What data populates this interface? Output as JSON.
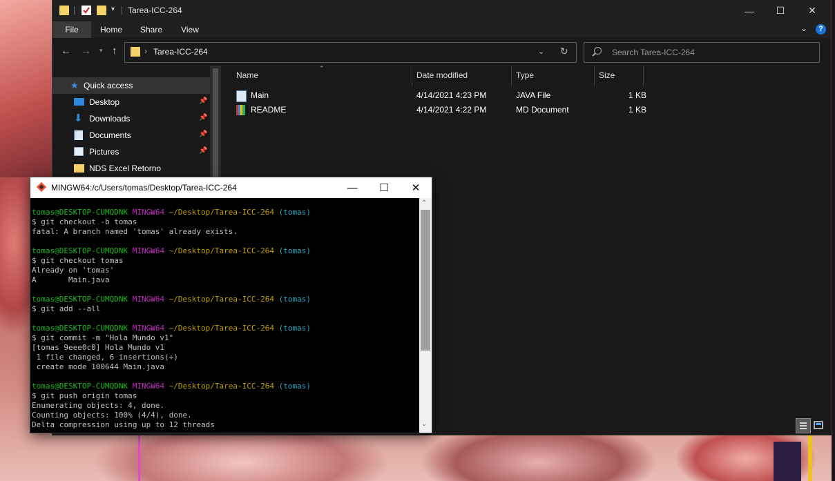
{
  "explorer": {
    "title": "Tarea-ICC-264",
    "ribbon_tabs": [
      "File",
      "Home",
      "Share",
      "View"
    ],
    "help": "?",
    "address": {
      "segment": "Tarea-ICC-264"
    },
    "search": {
      "placeholder": "Search Tarea-ICC-264"
    },
    "nav": [
      {
        "label": "Quick access",
        "icon": "star-icon",
        "pinned": false
      },
      {
        "label": "Desktop",
        "icon": "desktop-icon",
        "pinned": true
      },
      {
        "label": "Downloads",
        "icon": "download-icon",
        "pinned": true
      },
      {
        "label": "Documents",
        "icon": "documents-icon",
        "pinned": true
      },
      {
        "label": "Pictures",
        "icon": "pictures-icon",
        "pinned": true
      },
      {
        "label": "NDS Excel Retorno",
        "icon": "folder-icon",
        "pinned": false
      }
    ],
    "columns": [
      "Name",
      "Date modified",
      "Type",
      "Size"
    ],
    "files": [
      {
        "name": "Main",
        "date": "4/14/2021 4:23 PM",
        "type": "JAVA File",
        "size": "1 KB",
        "icon": "java-file-icon"
      },
      {
        "name": "README",
        "date": "4/14/2021 4:22 PM",
        "type": "MD Document",
        "size": "1 KB",
        "icon": "md-file-icon"
      }
    ]
  },
  "terminal": {
    "title": "MINGW64:/c/Users/tomas/Desktop/Tarea-ICC-264",
    "prompt": {
      "user": "tomas@DESKTOP-CUMQDNK",
      "shell": "MINGW64",
      "path": "~/Desktop/Tarea-ICC-264",
      "branch": "(tomas)"
    },
    "blocks": [
      {
        "command": "$ git checkout -b tomas",
        "output": [
          "fatal: A branch named 'tomas' already exists."
        ]
      },
      {
        "command": "$ git checkout tomas",
        "output": [
          "Already on 'tomas'",
          "A       Main.java"
        ]
      },
      {
        "command": "$ git add --all",
        "output": []
      },
      {
        "command": "$ git commit -m \"Hola Mundo v1\"",
        "output": [
          "[tomas 9eee0c0] Hola Mundo v1",
          " 1 file changed, 6 insertions(+)",
          " create mode 100644 Main.java"
        ]
      },
      {
        "command": "$ git push origin tomas",
        "output": [
          "Enumerating objects: 4, done.",
          "Counting objects: 100% (4/4), done.",
          "Delta compression using up to 12 threads"
        ]
      }
    ]
  },
  "colors": {
    "prompt_user": "#1fb91f",
    "prompt_shell": "#c22ac2",
    "prompt_path": "#c0a000",
    "prompt_branch": "#29a8c0",
    "folder": "#f5d36b",
    "accent": "#1a73d9"
  }
}
